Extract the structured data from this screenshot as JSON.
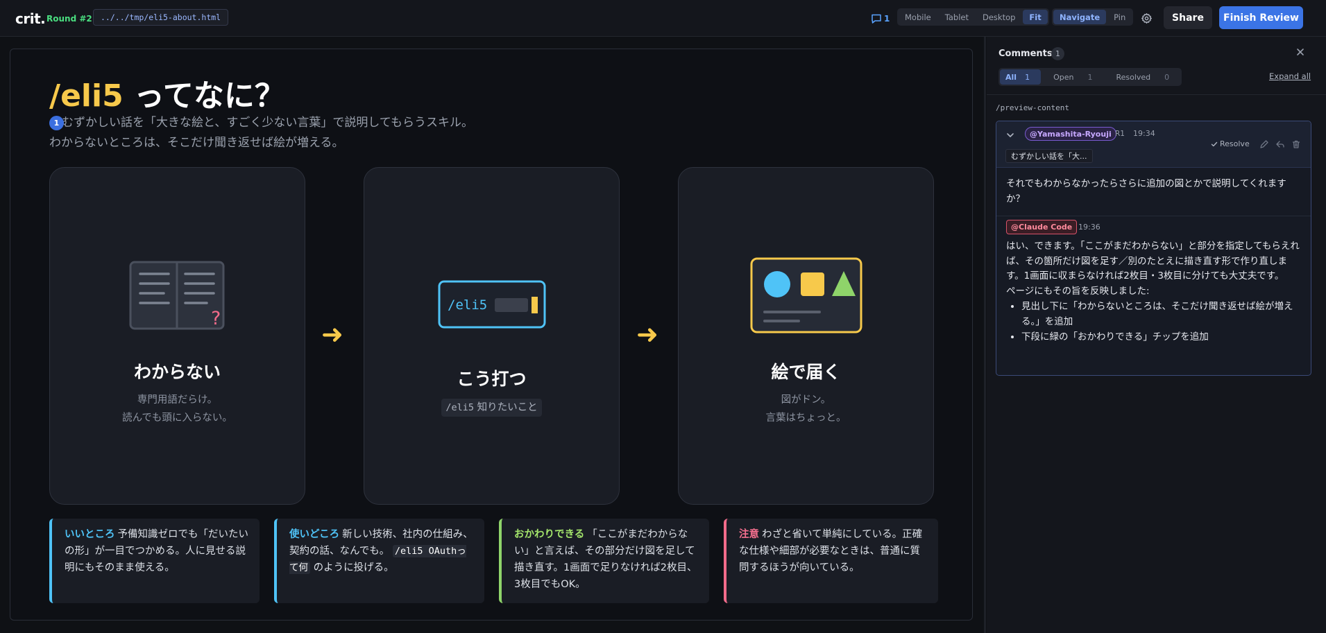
{
  "topbar": {
    "logo": "crit.",
    "round": "Round #2",
    "path": "../../tmp/eli5-about.html",
    "comment_count": "1",
    "viewports": [
      "Mobile",
      "Tablet",
      "Desktop",
      "Fit"
    ],
    "viewport_active": "Fit",
    "modes": [
      "Navigate",
      "Pin"
    ],
    "mode_active": "Navigate",
    "share": "Share",
    "finish": "Finish Review"
  },
  "preview": {
    "title_cmd": "/eli5",
    "title_rest": " ってなに？",
    "pin_number": "1",
    "sub_line1": "むずかしい話を「大きな絵と、すごく少ない言葉」で説明してもらうスキル。",
    "sub_line2": "わからないところは、そこだけ聞き返せば絵が増える。",
    "cards": [
      {
        "title": "わからない",
        "desc1": "専門用語だらけ。",
        "desc2": "読んでも頭に入らない。"
      },
      {
        "title": "こう打つ",
        "terminal_text": "/eli5",
        "chip_cmd": "/eli5",
        "chip_text": " 知りたいこと"
      },
      {
        "title": "絵で届く",
        "desc1": "図がドン。",
        "desc2": "言葉はちょっと。"
      }
    ],
    "arrow": "➜",
    "notes": [
      {
        "label": "いいところ",
        "text": "予備知識ゼロでも「だいたいの形」が一目でつかめる。人に見せる説明にもそのまま使える。"
      },
      {
        "label": "使いどころ",
        "text_before": "新しい技術、社内の仕組み、契約の話、なんでも。",
        "inline_code": "/eli5 OAuthって何",
        "text_after": " のように投げる。"
      },
      {
        "label": "おかわりできる",
        "text": "「ここがまだわからない」と言えば、その部分だけ図を足して描き直す。1画面で足りなければ2枚目、3枚目でもOK。"
      },
      {
        "label": "注意",
        "text": "わざと省いて単純にしている。正確な仕様や細部が必要なときは、普通に質問するほうが向いている。"
      }
    ]
  },
  "panel": {
    "title": "Comments",
    "count": "1",
    "filters": [
      {
        "label": "All",
        "n": "1"
      },
      {
        "label": "Open",
        "n": "1"
      },
      {
        "label": "Resolved",
        "n": "0"
      }
    ],
    "expand_all": "Expand all",
    "anchor": "/preview-content",
    "thread": {
      "author": "@Yamashita-Ryouji",
      "round": "R1",
      "time": "19:34",
      "quote": "むずかしい話を「大...",
      "resolve": "Resolve",
      "body": "それでもわからなかったらさらに追加の図とかで説明してくれますか？",
      "reply": {
        "author": "@Claude Code",
        "time": "19:36",
        "p1": "はい、できます。「ここがまだわからない」と部分を指定してもらえれば、その箇所だけ図を足す／別のたとえに描き直す形で作り直します。1画面に収まらなければ2枚目・3枚目に分けても大丈夫です。",
        "p2": "ページにもその旨を反映しました:",
        "bullets": [
          "見出し下に「わからないところは、そこだけ聞き返せば絵が増える。」を追加",
          "下段に緑の「おかわりできる」チップを追加"
        ]
      }
    }
  },
  "colors": {
    "accent_blue": "#3b74e6",
    "title_yellow": "#f7c94b",
    "note_cyan": "#4fc3f7",
    "note_green": "#a3e46b",
    "note_red": "#f6708f"
  },
  "icons": [
    "comment-icon",
    "gear-icon",
    "close-icon",
    "chevron-down-icon",
    "check-icon",
    "edit-icon",
    "reply-icon",
    "trash-icon",
    "book-icon",
    "terminal-icon",
    "picture-icon"
  ]
}
